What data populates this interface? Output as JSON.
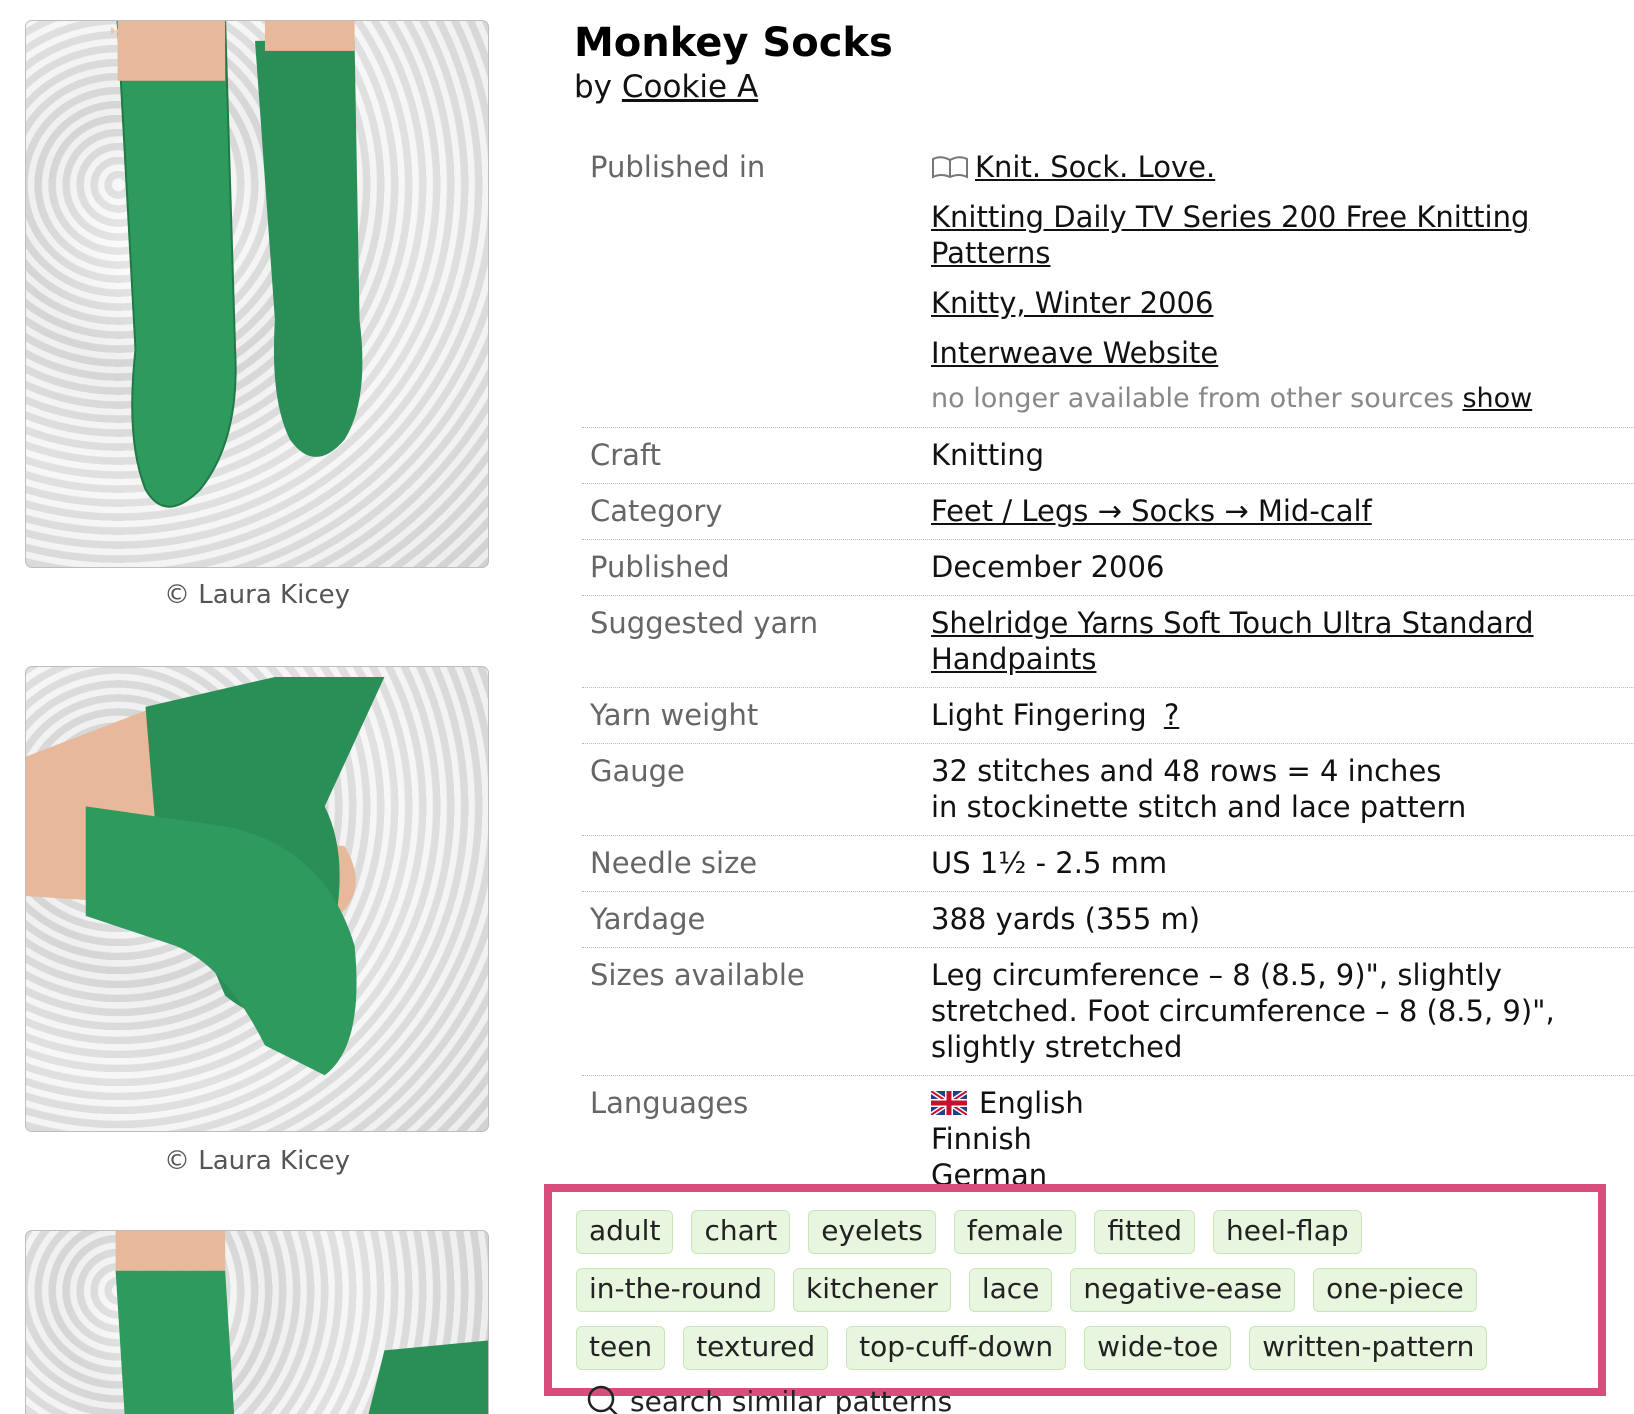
{
  "pattern": {
    "title": "Monkey Socks",
    "by_prefix": "by",
    "designer": "Cookie A"
  },
  "photos": [
    {
      "caption": "© Laura Kicey"
    },
    {
      "caption": "© Laura Kicey"
    },
    {
      "caption": ""
    }
  ],
  "details": {
    "published_in": {
      "label": "Published in",
      "links": [
        "Knit. Sock. Love.",
        "Knitting Daily TV Series 200 Free Knitting Patterns",
        "Knitty, Winter 2006",
        "Interweave Website"
      ],
      "no_longer_text": "no longer available from other sources",
      "show_label": "show"
    },
    "craft": {
      "label": "Craft",
      "value": "Knitting"
    },
    "category": {
      "label": "Category",
      "value": "Feet / Legs → Socks → Mid-calf"
    },
    "published": {
      "label": "Published",
      "value": "December 2006"
    },
    "suggested_yarn": {
      "label": "Suggested yarn",
      "value": "Shelridge Yarns Soft Touch Ultra Standard Handpaints"
    },
    "yarn_weight": {
      "label": "Yarn weight",
      "value": "Light Fingering",
      "help": "?"
    },
    "gauge": {
      "label": "Gauge",
      "line1": "32 stitches and 48 rows = 4 inches",
      "line2": "in stockinette stitch and lace pattern"
    },
    "needle_size": {
      "label": "Needle size",
      "value": "US 1½ - 2.5 mm"
    },
    "yardage": {
      "label": "Yardage",
      "value": "388 yards (355 m)"
    },
    "sizes": {
      "label": "Sizes available",
      "value": "Leg circumference – 8 (8.5, 9)\", slightly stretched. Foot circumference – 8 (8.5, 9)\", slightly stretched"
    },
    "languages": {
      "label": "Languages",
      "items": [
        "English",
        "Finnish",
        "German"
      ]
    }
  },
  "tags": [
    "adult",
    "chart",
    "eyelets",
    "female",
    "fitted",
    "heel-flap",
    "in-the-round",
    "kitchener",
    "lace",
    "negative-ease",
    "one-piece",
    "teen",
    "textured",
    "top-cuff-down",
    "wide-toe",
    "written-pattern"
  ],
  "search_similar_label": "search similar patterns",
  "colors": {
    "highlight_border": "#d94d7d",
    "tag_bg": "#e8f6df",
    "sock_green": "#2e9a5e"
  },
  "icons": {
    "book": "book-icon",
    "flag": "uk-flag-icon",
    "search": "search-icon"
  }
}
